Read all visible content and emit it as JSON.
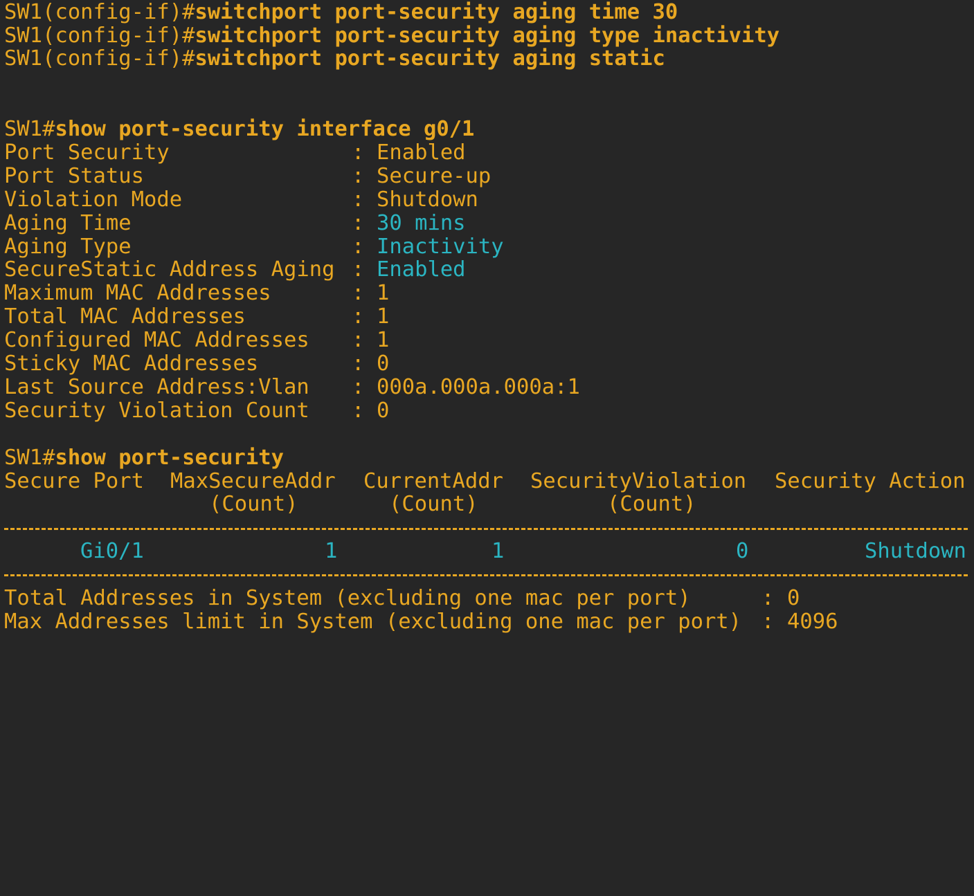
{
  "config_commands": [
    {
      "prompt": "SW1(config-if)#",
      "command": "switchport port-security aging time 30"
    },
    {
      "prompt": "SW1(config-if)#",
      "command": "switchport port-security aging type inactivity"
    },
    {
      "prompt": "SW1(config-if)#",
      "command": "switchport port-security aging static"
    }
  ],
  "show_interface": {
    "prompt": "SW1#",
    "command": "show port-security interface g0/1",
    "fields": [
      {
        "label": "Port Security",
        "value": "Enabled"
      },
      {
        "label": "Port Status",
        "value": "Secure-up"
      },
      {
        "label": "Violation Mode",
        "value": "Shutdown"
      },
      {
        "label": "Aging Time",
        "value": "30 mins"
      },
      {
        "label": "Aging Type",
        "value": "Inactivity"
      },
      {
        "label": "SecureStatic Address Aging",
        "value": "Enabled"
      },
      {
        "label": "Maximum MAC Addresses",
        "value": "1"
      },
      {
        "label": "Total MAC Addresses",
        "value": "1"
      },
      {
        "label": "Configured MAC Addresses",
        "value": "1"
      },
      {
        "label": "Sticky MAC Addresses",
        "value": "0"
      },
      {
        "label": "Last Source Address:Vlan",
        "value": "000a.000a.000a:1"
      },
      {
        "label": "Security Violation Count",
        "value": "0"
      }
    ],
    "separator": ":"
  },
  "show_port_security": {
    "prompt": "SW1#",
    "command": "show port-security",
    "headers": [
      "Secure Port",
      "MaxSecureAddr",
      "CurrentAddr",
      "SecurityViolation",
      "Security Action"
    ],
    "subheaders": [
      "(Count)",
      "(Count)",
      "(Count)"
    ],
    "row": {
      "port": "Gi0/1",
      "max": "1",
      "current": "1",
      "violation": "0",
      "action": "Shutdown"
    },
    "total_label": "Total Addresses in System (excluding one mac per port)",
    "total_value": "0",
    "max_label": "Max Addresses limit in System (excluding one mac per port)",
    "max_value": "4096"
  },
  "colors": {
    "background": "#262626",
    "text": "#e8a722",
    "highlight": "#2bb5c2"
  }
}
